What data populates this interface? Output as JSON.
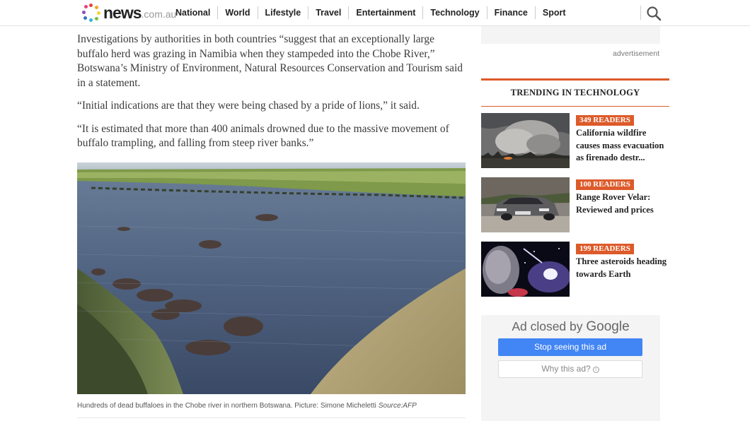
{
  "header": {
    "logo_text": "news",
    "logo_suffix": ".com.au",
    "nav": [
      "National",
      "World",
      "Lifestyle",
      "Travel",
      "Entertainment",
      "Technology",
      "Finance",
      "Sport"
    ]
  },
  "article": {
    "paragraphs": [
      "Investigations by authorities in both countries “suggest that an exceptionally large buffalo herd was grazing in Namibia when they stampeded into the Chobe River,” Botswana’s Ministry of Environment, Natural Resources Conservation and Tourism said in a statement.",
      "“Initial indications are that they were being chased by a pride of lions,” it said.",
      "“It is estimated that more than 400 animals drowned due to the massive movement of buffalo trampling, and falling from steep river banks.”"
    ],
    "caption": "Hundreds of dead buffaloes in the Chobe river in northern Botswana. Picture: Simone Micheletti",
    "caption_source": "Source:AFP"
  },
  "sidebar": {
    "advertisement_label": "advertisement",
    "trending_title": "TRENDING IN TECHNOLOGY",
    "trending": [
      {
        "readers": "349 READERS",
        "headline": "California wildfire causes mass evacuation as firenado destr..."
      },
      {
        "readers": "100 READERS",
        "headline": "Range Rover Velar: Reviewed and prices"
      },
      {
        "readers": "199 READERS",
        "headline": "Three asteroids heading towards Earth"
      }
    ],
    "ad_closed": {
      "title_prefix": "Ad closed by",
      "title_brand": "Google",
      "stop_label": "Stop seeing this ad",
      "why_label": "Why this ad?"
    }
  },
  "colors": {
    "accent": "#dd5a2a",
    "google_blue": "#4285f4"
  }
}
